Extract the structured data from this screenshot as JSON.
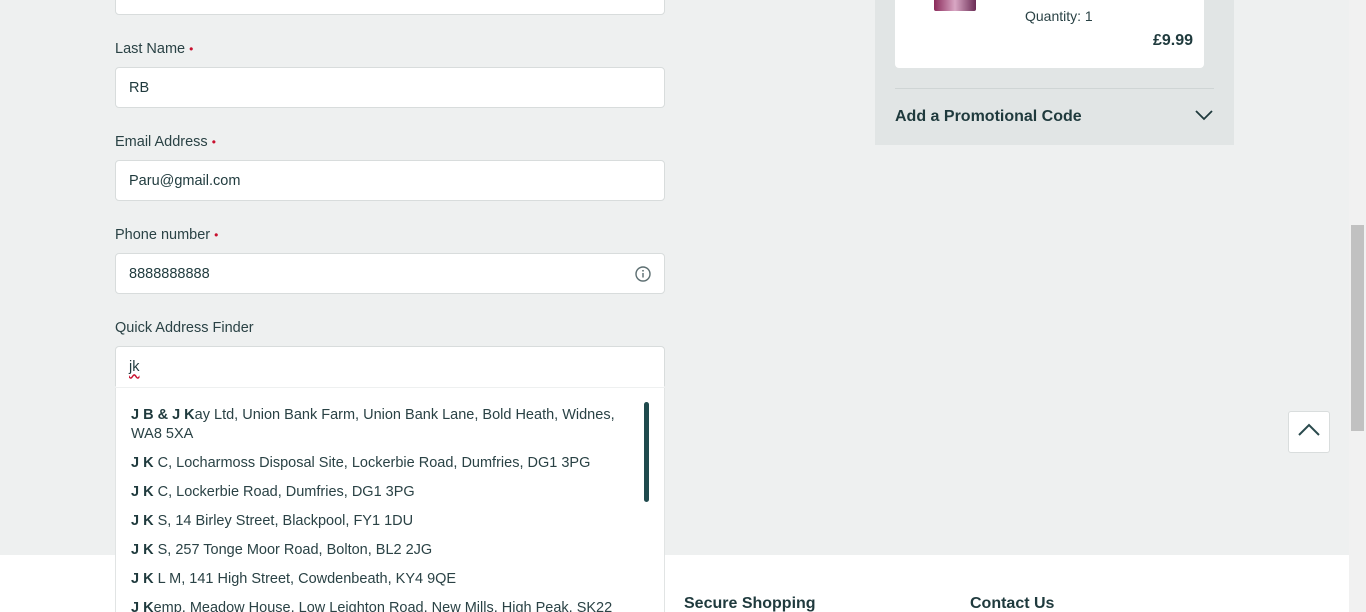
{
  "form": {
    "last_name": {
      "label": "Last Name",
      "required": "•",
      "value": "RB"
    },
    "email": {
      "label": "Email Address",
      "required": "•",
      "value": "Paru@gmail.com"
    },
    "phone": {
      "label": "Phone number",
      "required": "•",
      "value": "8888888888",
      "icon": "info-icon"
    },
    "address_finder": {
      "label": "Quick Address Finder",
      "value": "jk"
    }
  },
  "address_suggestions": [
    {
      "match": "J B & J K",
      "rest": "ay Ltd, Union Bank Farm, Union Bank Lane, Bold Heath, Widnes, WA8 5XA"
    },
    {
      "match": "J K",
      "rest": " C, Locharmoss Disposal Site, Lockerbie Road, Dumfries, DG1 3PG"
    },
    {
      "match": "J K",
      "rest": " C, Lockerbie Road, Dumfries, DG1 3PG"
    },
    {
      "match": "J K",
      "rest": " S, 14 Birley Street, Blackpool, FY1 1DU"
    },
    {
      "match": "J K",
      "rest": " S, 257 Tonge Moor Road, Bolton, BL2 2JG"
    },
    {
      "match": "J K",
      "rest": " L M, 141 High Street, Cowdenbeath, KY4 9QE"
    },
    {
      "match": "J K",
      "rest": "emp, Meadow House, Low Leighton Road, New Mills, High Peak, SK22"
    }
  ],
  "summary": {
    "quantity": "Quantity: 1",
    "price": "£9.99",
    "promo_label": "Add a Promotional Code"
  },
  "footer": {
    "secure_shopping": "Secure Shopping",
    "contact_us": "Contact Us"
  },
  "colors": {
    "accent": "#1f3a3d",
    "required": "#c8102e",
    "background": "#eef0f0"
  }
}
